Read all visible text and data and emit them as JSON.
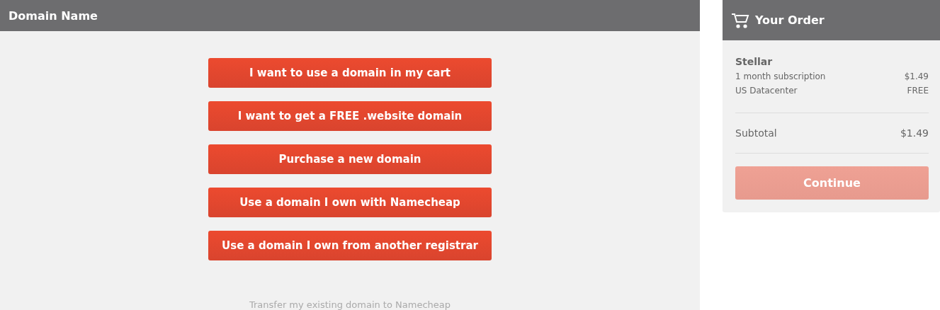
{
  "main": {
    "title": "Domain Name",
    "options": [
      {
        "label": "I want to use a domain in my cart"
      },
      {
        "label": "I want to get a FREE .website domain"
      },
      {
        "label": "Purchase a new domain"
      },
      {
        "label": "Use a domain I own with Namecheap"
      },
      {
        "label": "Use a domain I own from another registrar"
      }
    ],
    "note": "Transfer my existing domain to Namecheap"
  },
  "order": {
    "title": "Your Order",
    "product": "Stellar",
    "lines": [
      {
        "label": "1 month subscription",
        "price": "$1.49"
      },
      {
        "label": "US Datacenter",
        "price": "FREE"
      }
    ],
    "subtotal": {
      "label": "Subtotal",
      "price": "$1.49"
    },
    "button": {
      "label": "Continue",
      "disabled": true
    }
  }
}
